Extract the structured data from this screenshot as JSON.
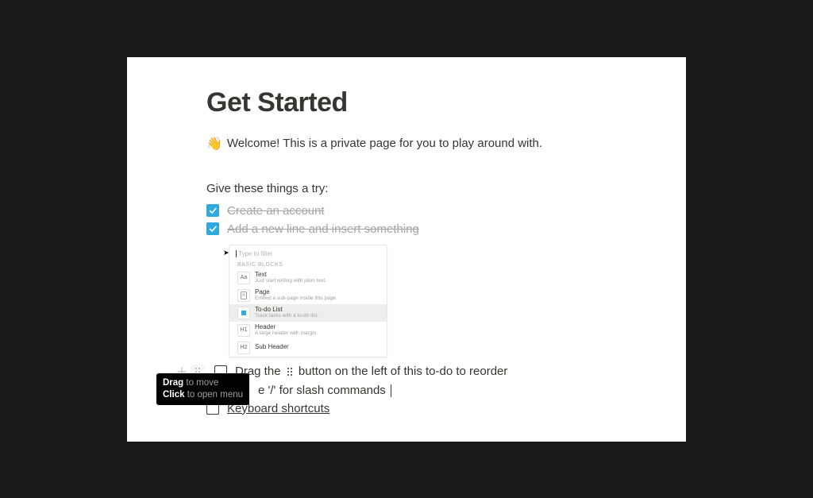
{
  "page": {
    "title": "Get Started",
    "welcome_emoji": "👋",
    "welcome_text": "Welcome! This is a private page for you to play around with.",
    "try_heading": "Give these things a try:"
  },
  "todos": [
    {
      "checked": true,
      "text": "Create an account"
    },
    {
      "checked": true,
      "text": "Add a new line and insert something"
    }
  ],
  "drag_row": {
    "text_before": "Drag the",
    "text_after": "button on the left of this to-do to reorder"
  },
  "slash_cmd_row": {
    "visible_text": "e '/' for slash commands"
  },
  "keyboard_row": {
    "text": "Keyboard shortcuts"
  },
  "slash_menu": {
    "filter_placeholder": "Type to filter",
    "section": "BASIC BLOCKS",
    "items": [
      {
        "icon": "Aa",
        "title": "Text",
        "desc": "Just start writing with plain text."
      },
      {
        "icon": "page",
        "title": "Page",
        "desc": "Embed a sub-page inside this page."
      },
      {
        "icon": "todo",
        "title": "To-do List",
        "desc": "Track tasks with a to-do list."
      },
      {
        "icon": "H1",
        "title": "Header",
        "desc": "A large header with margin."
      },
      {
        "icon": "H2",
        "title": "Sub Header",
        "desc": ""
      }
    ],
    "selected_index": 2
  },
  "tooltip": {
    "line1_strong": "Drag",
    "line1_rest": " to move",
    "line2_strong": "Click",
    "line2_rest": " to open menu"
  }
}
